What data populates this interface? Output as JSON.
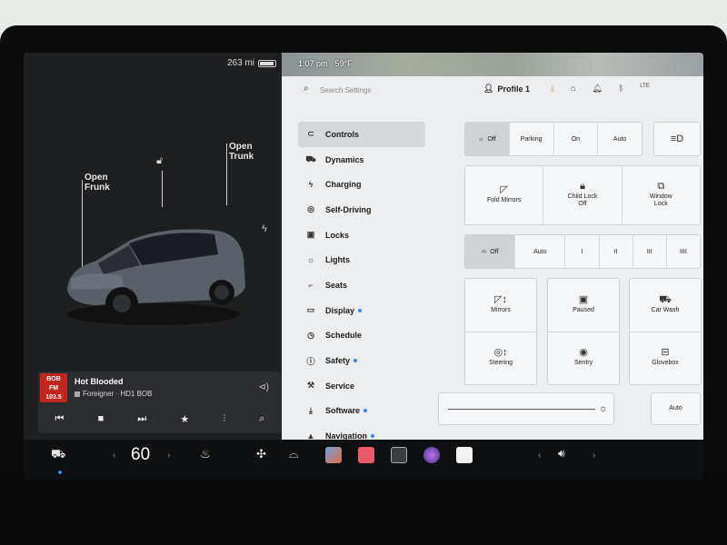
{
  "left": {
    "range": "263 mi",
    "callouts": {
      "frunk_line1": "Open",
      "frunk_line2": "Frunk",
      "trunk_line1": "Open",
      "trunk_line2": "Trunk"
    },
    "media": {
      "station_logo_line1": "BOB",
      "station_logo_line2": "FM",
      "station_logo_line3": "103.5",
      "track": "Hot Blooded",
      "artist": "Foreigner · HD1 BOB"
    }
  },
  "map": {
    "time": "1:07 pm",
    "temp": "59°F"
  },
  "header": {
    "search_placeholder": "Search Settings",
    "profile": "Profile 1",
    "lte": "LTE"
  },
  "menu": [
    {
      "label": "Controls",
      "icon": "toggle-icon",
      "glyph": "⊂",
      "active": true,
      "dot": false
    },
    {
      "label": "Dynamics",
      "icon": "car-icon",
      "glyph": "⛟",
      "active": false,
      "dot": false
    },
    {
      "label": "Charging",
      "icon": "bolt-icon",
      "glyph": "ϟ",
      "active": false,
      "dot": false
    },
    {
      "label": "Self-Driving",
      "icon": "steering-wheel-icon",
      "glyph": "◎",
      "active": false,
      "dot": false
    },
    {
      "label": "Locks",
      "icon": "lock-icon",
      "glyph": "▣",
      "active": false,
      "dot": false
    },
    {
      "label": "Lights",
      "icon": "sun-icon",
      "glyph": "☼",
      "active": false,
      "dot": false
    },
    {
      "label": "Seats",
      "icon": "seat-icon",
      "glyph": "⌐",
      "active": false,
      "dot": false
    },
    {
      "label": "Display",
      "icon": "display-icon",
      "glyph": "▭",
      "active": false,
      "dot": true
    },
    {
      "label": "Schedule",
      "icon": "clock-icon",
      "glyph": "◷",
      "active": false,
      "dot": false
    },
    {
      "label": "Safety",
      "icon": "warning-icon",
      "glyph": "ⓘ",
      "active": false,
      "dot": true
    },
    {
      "label": "Service",
      "icon": "wrench-icon",
      "glyph": "⚒",
      "active": false,
      "dot": false
    },
    {
      "label": "Software",
      "icon": "download-icon",
      "glyph": "⤓",
      "active": false,
      "dot": true
    },
    {
      "label": "Navigation",
      "icon": "navigation-icon",
      "glyph": "▲",
      "active": false,
      "dot": true
    }
  ],
  "controls": {
    "lights": {
      "off": "Off",
      "parking": "Parking",
      "on": "On",
      "auto": "Auto"
    },
    "mirrors_row": {
      "fold": "Fold Mirrors",
      "child_lock": "Child Lock",
      "child_lock_state": "Off",
      "window_lock_1": "Window",
      "window_lock_2": "Lock"
    },
    "wipers": {
      "off": "Off",
      "auto": "Auto",
      "s1": "I",
      "s2": "II",
      "s3": "III",
      "s4": "IIII"
    },
    "grid": {
      "mirrors": "Mirrors",
      "paused": "Paused",
      "car_wash": "Car Wash",
      "steering": "Steering",
      "sentry": "Sentry",
      "glovebox": "Glovebox"
    },
    "brightness_auto": "Auto"
  },
  "dock": {
    "temperature": "60"
  }
}
